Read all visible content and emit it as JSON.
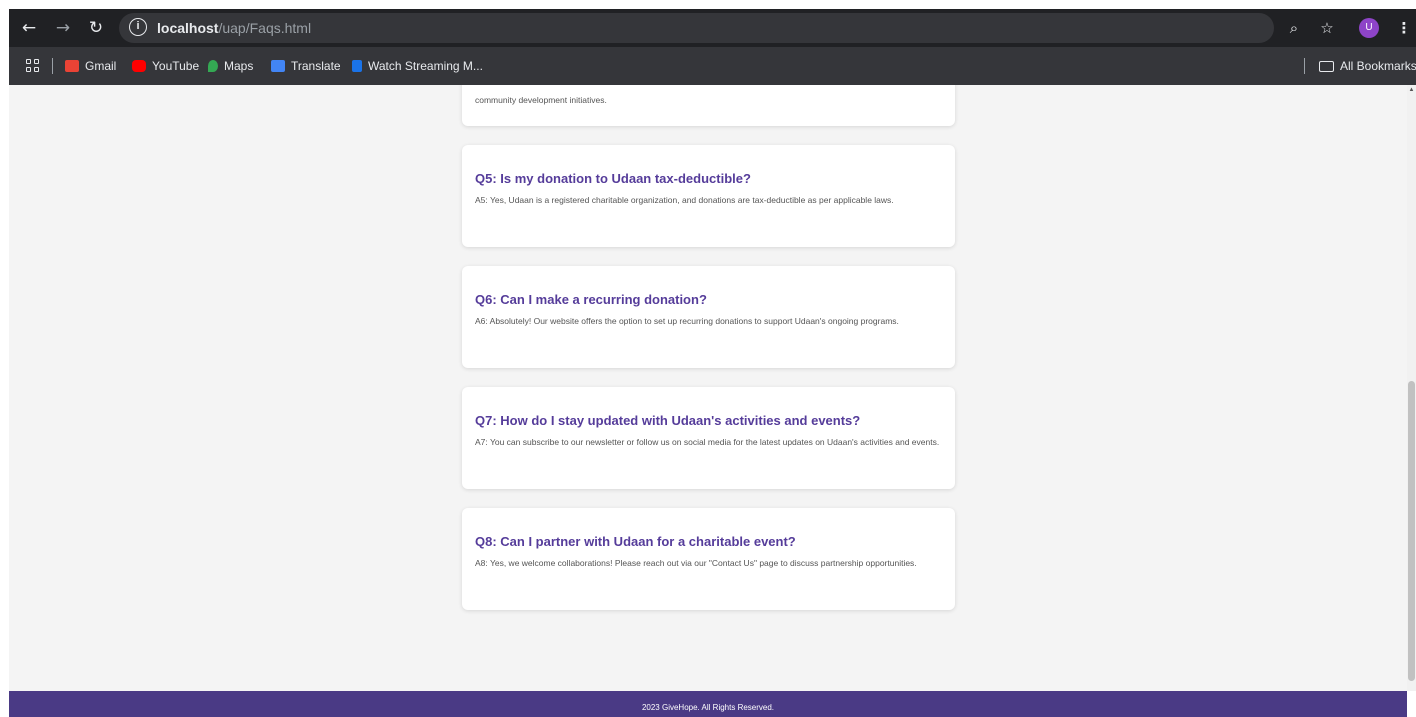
{
  "browser": {
    "url_host": "localhost",
    "url_path": "/uap/Faqs.html",
    "profile_initial": "U",
    "bookmarks": [
      {
        "label": "Gmail",
        "color": "#ea4335"
      },
      {
        "label": "YouTube",
        "color": "#ff0000"
      },
      {
        "label": "Maps",
        "color": "#34a853"
      },
      {
        "label": "Translate",
        "color": "#4285f4"
      },
      {
        "label": "Watch Streaming M...",
        "color": "#1a73e8"
      }
    ],
    "all_bookmarks_label": "All Bookmarks"
  },
  "faqs": {
    "partial_answer": "community development initiatives.",
    "items": [
      {
        "question": "Q5: Is my donation to Udaan tax-deductible?",
        "answer": "A5: Yes, Udaan is a registered charitable organization, and donations are tax-deductible as per applicable laws."
      },
      {
        "question": "Q6: Can I make a recurring donation?",
        "answer": "A6: Absolutely! Our website offers the option to set up recurring donations to support Udaan's ongoing programs."
      },
      {
        "question": "Q7: How do I stay updated with Udaan's activities and events?",
        "answer": "A7: You can subscribe to our newsletter or follow us on social media for the latest updates on Udaan's activities and events."
      },
      {
        "question": "Q8: Can I partner with Udaan for a charitable event?",
        "answer": "A8: Yes, we welcome collaborations! Please reach out via our \"Contact Us\" page to discuss partnership opportunities."
      }
    ]
  },
  "footer": {
    "text": "2023 GiveHope. All Rights Reserved."
  },
  "colors": {
    "accent": "#553c9a",
    "footer_bg": "#4a3a85"
  }
}
